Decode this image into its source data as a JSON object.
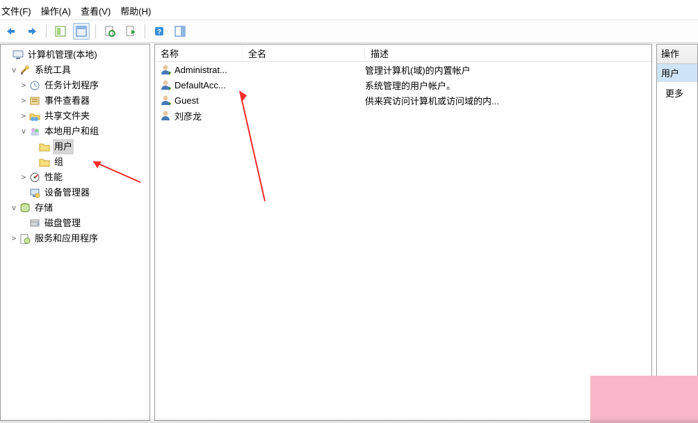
{
  "menu": {
    "file": "文件(F)",
    "action": "操作(A)",
    "view": "查看(V)",
    "help": "帮助(H)"
  },
  "tree": {
    "root": "计算机管理(本地)",
    "sys_tools": "系统工具",
    "task_sched": "任务计划程序",
    "event_viewer": "事件查看器",
    "shared_folders": "共享文件夹",
    "local_users": "本地用户和组",
    "users": "用户",
    "groups": "组",
    "performance": "性能",
    "device_mgr": "设备管理器",
    "storage": "存储",
    "disk_mgmt": "磁盘管理",
    "services_apps": "服务和应用程序"
  },
  "columns": {
    "name": "名称",
    "fullname": "全名",
    "desc": "描述"
  },
  "users": [
    {
      "name": "Administrat...",
      "fullname": "",
      "desc": "管理计算机(域)的内置帐户"
    },
    {
      "name": "DefaultAcc...",
      "fullname": "",
      "desc": "系统管理的用户帐户。"
    },
    {
      "name": "Guest",
      "fullname": "",
      "desc": "供来宾访问计算机或访问域的内..."
    },
    {
      "name": "刘彦龙",
      "fullname": "",
      "desc": ""
    }
  ],
  "actions": {
    "header": "操作",
    "selected": "用户",
    "more": "更多"
  }
}
